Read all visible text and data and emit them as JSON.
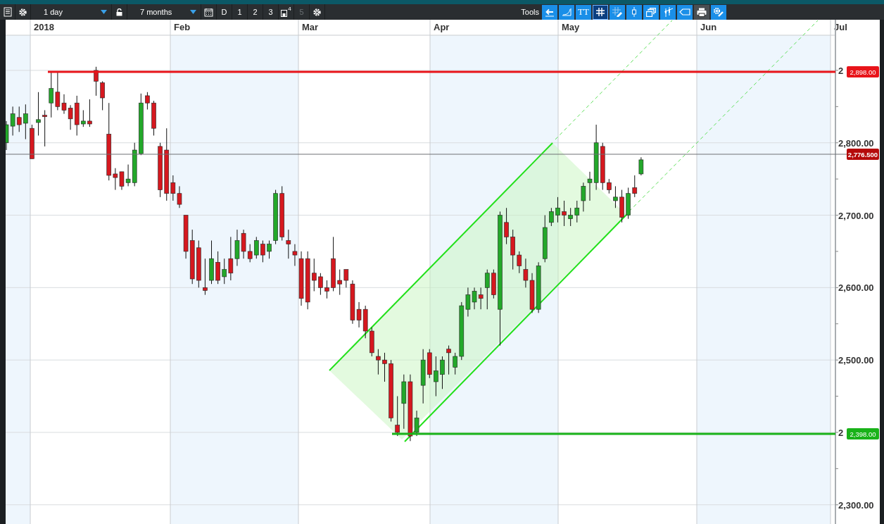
{
  "toolbar": {
    "interval": {
      "value": "1 day"
    },
    "range": {
      "value": "7 months"
    },
    "presets": [
      {
        "label": "D",
        "disabled": false
      },
      {
        "label": "1",
        "disabled": false
      },
      {
        "label": "2",
        "disabled": false
      },
      {
        "label": "3",
        "disabled": false
      }
    ],
    "save_slot": {
      "label": "4"
    },
    "extra_presets": [
      {
        "label": "5",
        "disabled": true
      }
    ],
    "tools_label": "Tools",
    "tools": [
      {
        "kind": "back",
        "selected": false
      },
      {
        "kind": "curve",
        "selected": false
      },
      {
        "kind": "text",
        "label": "TT",
        "selected": false
      },
      {
        "kind": "grid",
        "selected": true
      },
      {
        "kind": "draw",
        "selected": false
      },
      {
        "kind": "candle",
        "selected": false
      },
      {
        "kind": "windows",
        "selected": false
      },
      {
        "kind": "bars",
        "selected": false
      },
      {
        "kind": "tag",
        "selected": false
      },
      {
        "kind": "print",
        "selected": false
      },
      {
        "kind": "settings",
        "selected": false
      }
    ]
  },
  "chart": {
    "months": [
      "2018",
      "Feb",
      "Mar",
      "Apr",
      "May",
      "Jun",
      "Jul"
    ],
    "price_axis": [
      "2",
      "2,800.00",
      "2,700.00",
      "2,600.00",
      "2,500.00",
      "2",
      "2,300.00"
    ],
    "price_tags": [
      {
        "label": "2,898.00",
        "kind": "resistance",
        "color": "#e8141a"
      },
      {
        "label": "2,776.500",
        "kind": "last",
        "color": "#b50a0a"
      },
      {
        "label": "2,398.00",
        "kind": "support",
        "color": "#19b219"
      }
    ]
  }
}
